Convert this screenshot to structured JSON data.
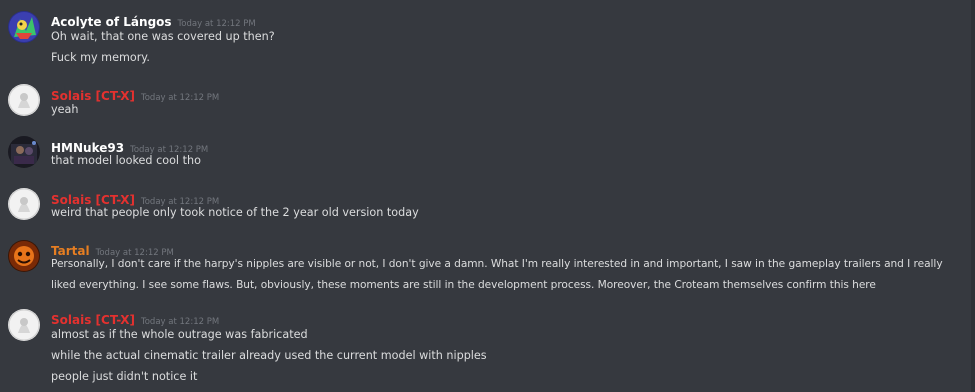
{
  "colors": {
    "background": "#36393f",
    "text": "#dcddde",
    "timestamp": "#72767d",
    "username_default": "#ffffff",
    "username_red": "#e4312f",
    "username_orange": "#e67e22"
  },
  "messages": [
    {
      "author": "Acolyte of Lángos",
      "timestamp": "Today at 12:12 PM",
      "avatar": "acolyte-avatar-icon",
      "lines": [
        "Oh wait, that one was covered up then?",
        "Fuck my memory."
      ]
    },
    {
      "author": "Solais [CT-X]",
      "timestamp": "Today at 12:12 PM",
      "avatar": "solais-avatar-icon",
      "lines": [
        "yeah"
      ]
    },
    {
      "author": "HMNuke93",
      "timestamp": "Today at 12:12 PM",
      "avatar": "hmnuke-avatar-icon",
      "lines": [
        "that model looked cool tho"
      ]
    },
    {
      "author": "Solais [CT-X]",
      "timestamp": "Today at 12:12 PM",
      "avatar": "solais-avatar-icon",
      "lines": [
        "weird that people only took notice of the 2 year old version today"
      ]
    },
    {
      "author": "Tartal",
      "timestamp": "Today at 12:12 PM",
      "avatar": "tartal-avatar-icon",
      "lines": [
        "Personally, I don't care if the harpy's nipples are visible or not, I don't give a damn. What I'm really interested in and important, I saw in the gameplay trailers and I really liked everything. I see some flaws. But, obviously, these moments are still in the development process. Moreover, the Croteam themselves confirm this here"
      ]
    },
    {
      "author": "Solais [CT-X]",
      "timestamp": "Today at 12:12 PM",
      "avatar": "solais-avatar-icon",
      "lines": [
        "almost as if the whole outrage was fabricated",
        "while the actual cinematic trailer already used the current model with nipples",
        "people just didn't notice it"
      ]
    }
  ]
}
